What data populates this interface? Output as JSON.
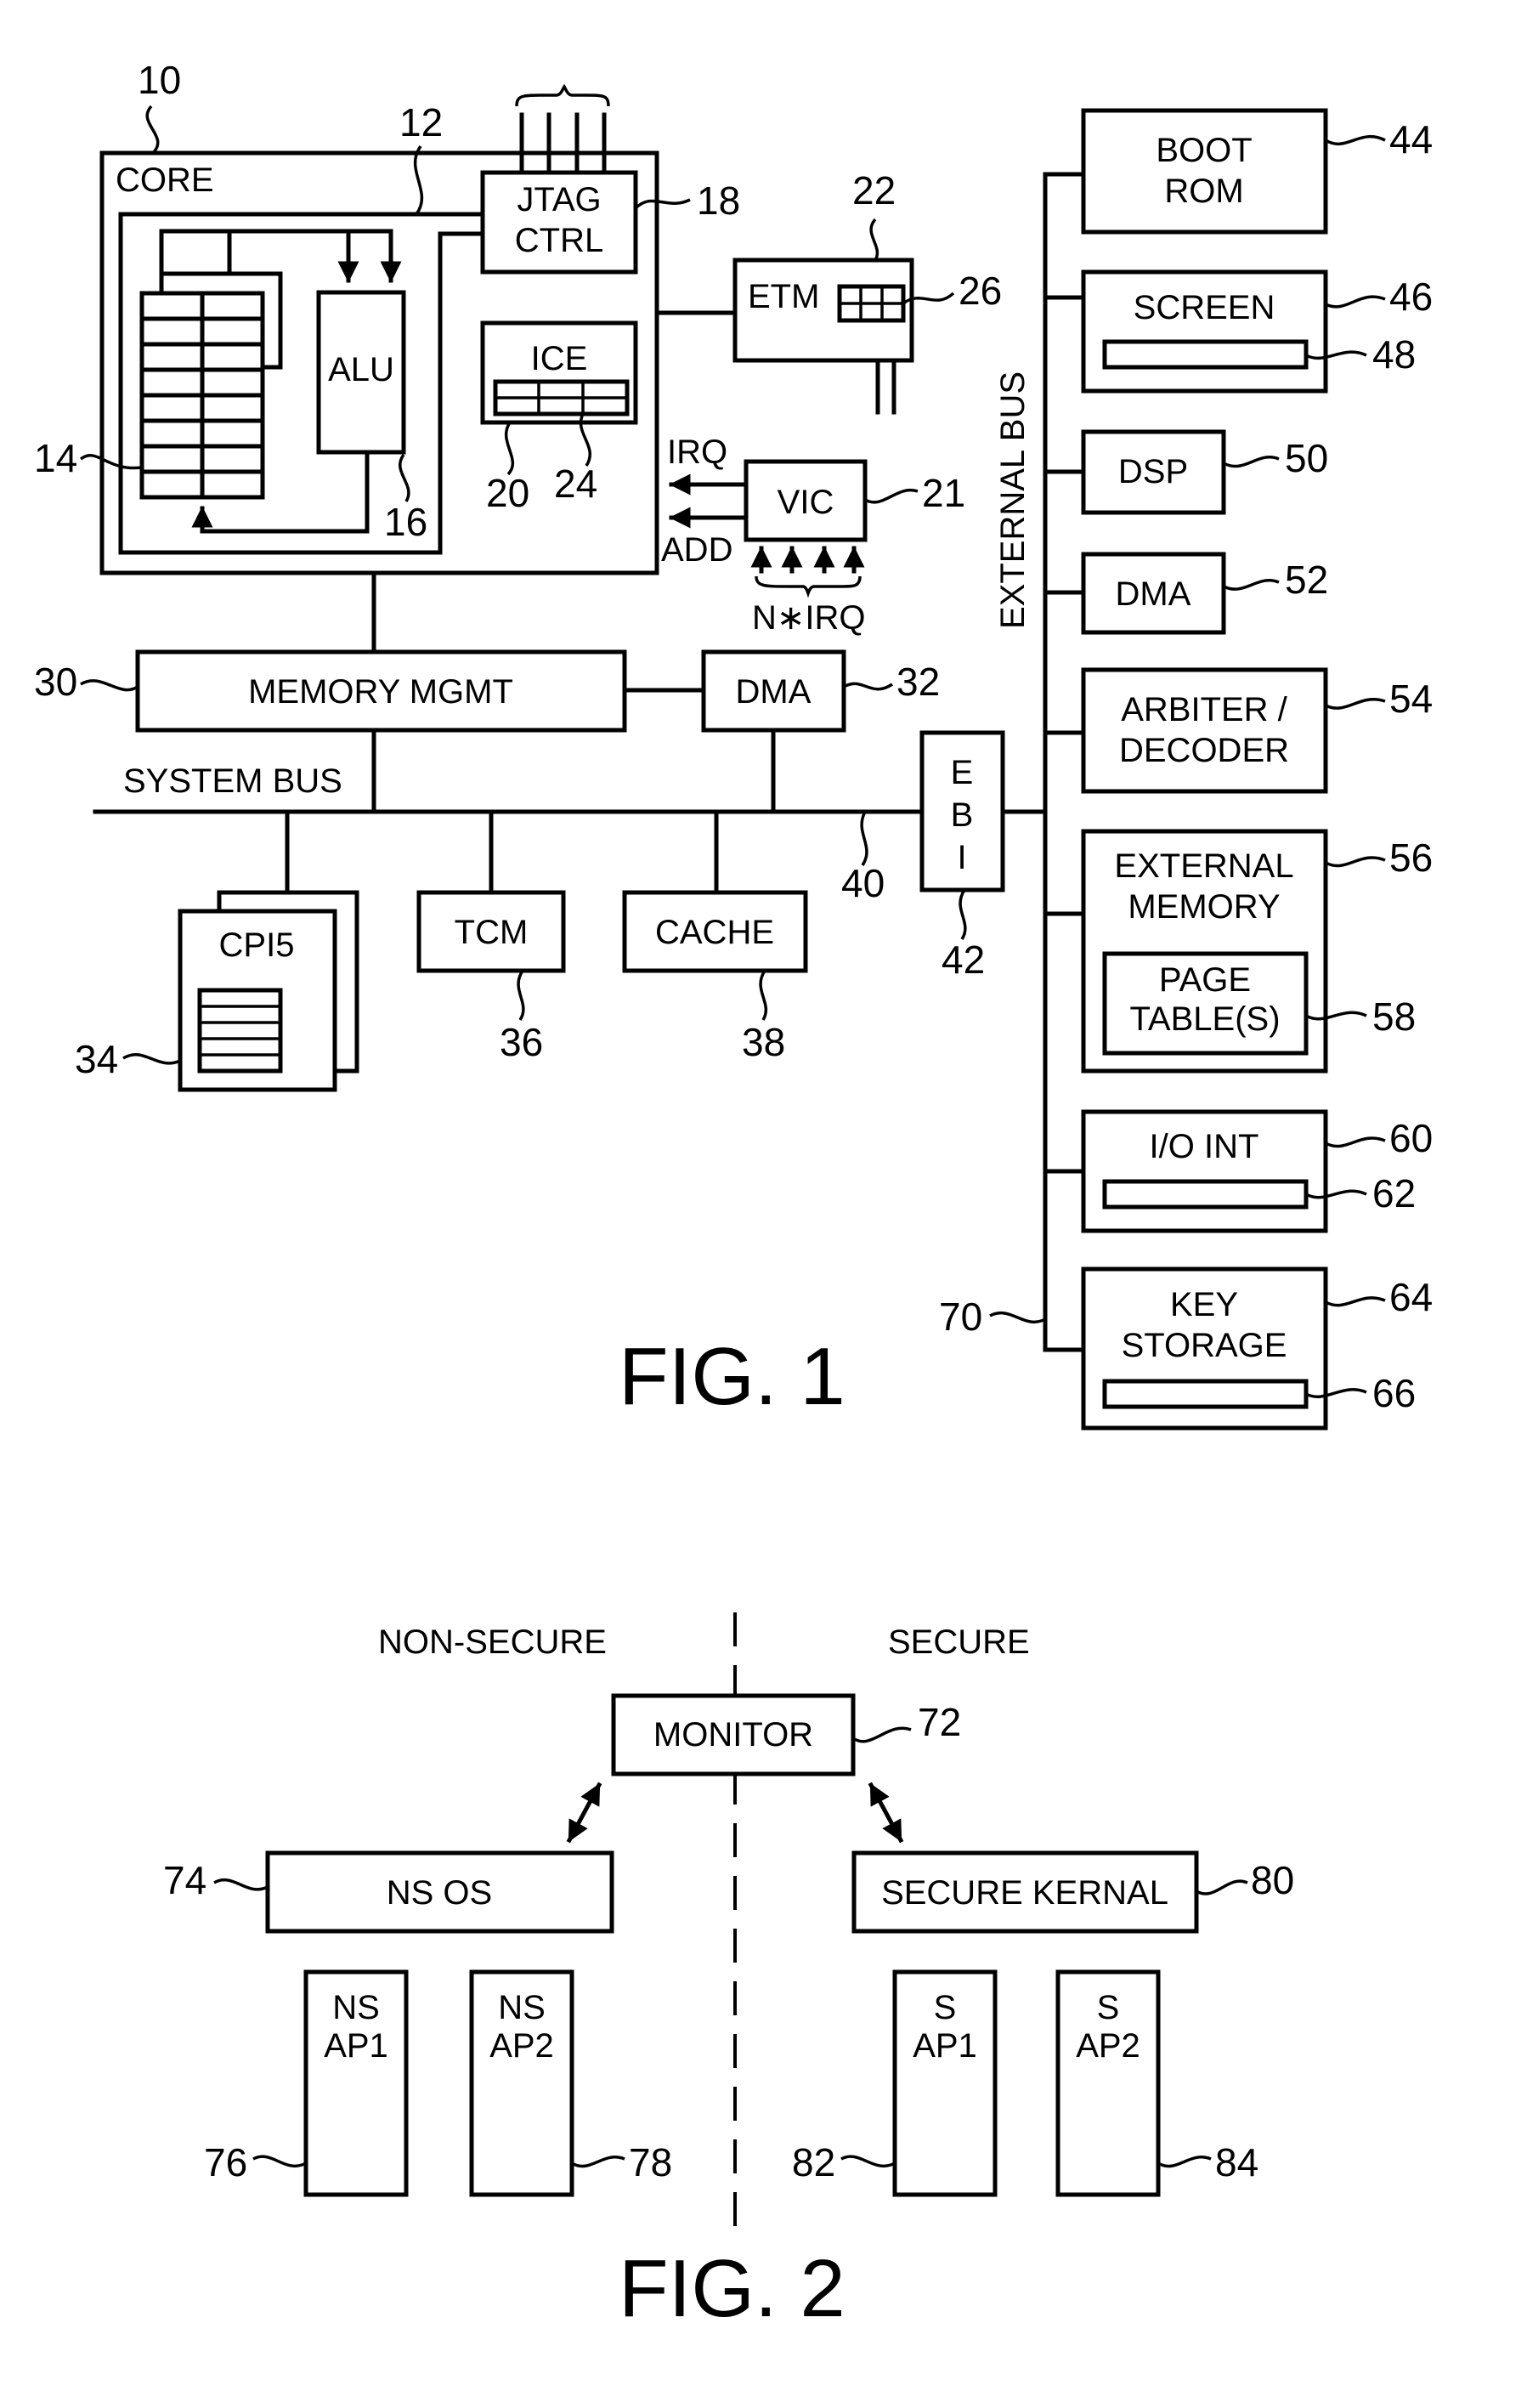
{
  "fig1": {
    "caption": "FIG. 1",
    "core": {
      "label": "CORE",
      "ref": "10"
    },
    "datapath_ref": "12",
    "register_bank_ref": "14",
    "alu": {
      "label": "ALU",
      "ref": "16"
    },
    "jtag": {
      "line1": "JTAG",
      "line2": "CTRL",
      "ref": "18"
    },
    "ice": {
      "label": "ICE",
      "ref_a": "20",
      "ref_b": "24"
    },
    "vic": {
      "label": "VIC",
      "ref": "21",
      "irq_label": "IRQ",
      "add_label": "ADD",
      "nirq_label": "N∗IRQ"
    },
    "etm": {
      "label": "ETM",
      "ref": "22",
      "buffer_ref": "26"
    },
    "memory_mgmt": {
      "label": "MEMORY MGMT",
      "ref": "30"
    },
    "dma_internal": {
      "label": "DMA",
      "ref": "32"
    },
    "system_bus": {
      "label": "SYSTEM BUS",
      "ref": "40"
    },
    "cp15": {
      "label": "CPI5",
      "ref": "34"
    },
    "tcm": {
      "label": "TCM",
      "ref": "36"
    },
    "cache": {
      "label": "CACHE",
      "ref": "38"
    },
    "ebi": {
      "letters": [
        "E",
        "B",
        "I"
      ],
      "ref": "42"
    },
    "external_bus": {
      "label": "EXTERNAL BUS",
      "ref": "70"
    },
    "boot_rom": {
      "line1": "BOOT",
      "line2": "ROM",
      "ref": "44"
    },
    "screen": {
      "label": "SCREEN",
      "ref": "46",
      "inner_ref": "48"
    },
    "dsp": {
      "label": "DSP",
      "ref": "50"
    },
    "dma_external": {
      "label": "DMA",
      "ref": "52"
    },
    "arbiter": {
      "line1": "ARBITER /",
      "line2": "DECODER",
      "ref": "54"
    },
    "external_memory": {
      "line1": "EXTERNAL",
      "line2": "MEMORY",
      "ref": "56"
    },
    "page_tables": {
      "line1": "PAGE",
      "line2": "TABLE(S)",
      "ref": "58"
    },
    "io_int": {
      "label": "I/O INT",
      "ref": "60",
      "inner_ref": "62"
    },
    "key_storage": {
      "line1": "KEY",
      "line2": "STORAGE",
      "ref": "64",
      "inner_ref": "66"
    }
  },
  "fig2": {
    "caption": "FIG. 2",
    "non_secure_label": "NON-SECURE",
    "secure_label": "SECURE",
    "monitor": {
      "label": "MONITOR",
      "ref": "72"
    },
    "ns_os": {
      "label": "NS OS",
      "ref": "74"
    },
    "secure_kernel": {
      "label": "SECURE KERNAL",
      "ref": "80"
    },
    "ns_ap1": {
      "line1": "NS",
      "line2": "AP1",
      "ref": "76"
    },
    "ns_ap2": {
      "line1": "NS",
      "line2": "AP2",
      "ref": "78"
    },
    "s_ap1": {
      "line1": "S",
      "line2": "AP1",
      "ref": "82"
    },
    "s_ap2": {
      "line1": "S",
      "line2": "AP2",
      "ref": "84"
    }
  }
}
